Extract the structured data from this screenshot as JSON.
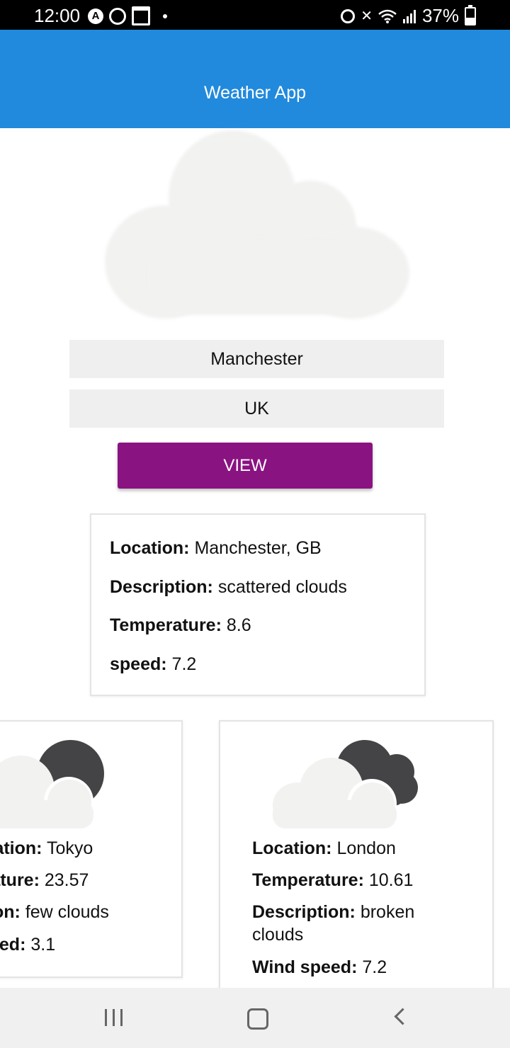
{
  "status_bar": {
    "time": "12:00",
    "battery": "37%",
    "battery_level": 0.37
  },
  "app_bar": {
    "title": "Weather App"
  },
  "search": {
    "city_value": "Manchester",
    "country_value": "UK",
    "view_label": "VIEW"
  },
  "result": {
    "location_label": "Location:",
    "location_value": "Manchester, GB",
    "description_label": "Description:",
    "description_value": "scattered clouds",
    "temperature_label": "Temperature:",
    "temperature_value": "8.6",
    "speed_label": "speed:",
    "speed_value": "7.2"
  },
  "cities": [
    {
      "icon": "cloud-with-moon-icon",
      "location_label": "Location:",
      "location_value": "Tokyo",
      "temperature_label": "Temperature:",
      "temperature_value": "23.57",
      "description_label": "Description:",
      "description_value": "few clouds",
      "wind_label": "Wind speed:",
      "wind_value": "3.1"
    },
    {
      "icon": "cloud-with-dark-cloud-icon",
      "location_label": "Location:",
      "location_value": "London",
      "temperature_label": "Temperature:",
      "temperature_value": "10.61",
      "description_label": "Description:",
      "description_value_line1": "broken",
      "description_value_line2": "clouds",
      "wind_label": "Wind speed:",
      "wind_value": "7.2"
    }
  ],
  "colors": {
    "app_bar": "#218adc",
    "view_button": "#8a1382",
    "cloud": "#f2f2f1",
    "dark_icon": "#444446"
  }
}
